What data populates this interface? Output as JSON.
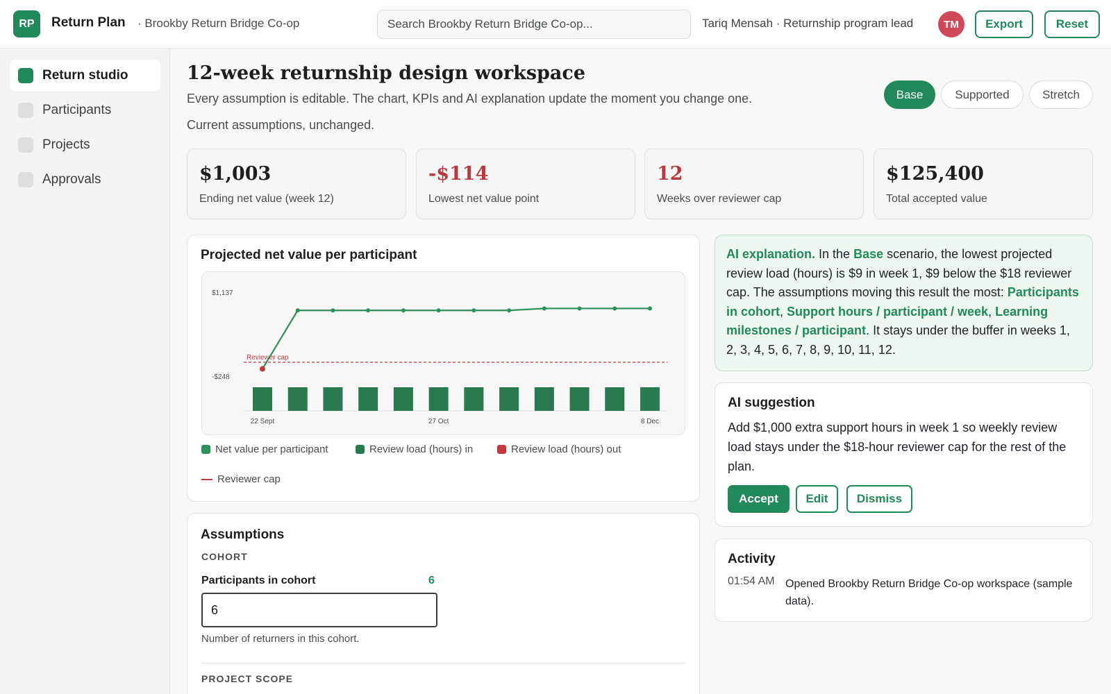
{
  "header": {
    "logo_initials": "RP",
    "app_title": "Return Plan",
    "org_name": "· Brookby Return Bridge Co-op",
    "search_placeholder": "Search Brookby Return Bridge Co-op...",
    "user_info": "Tariq Mensah · Returnship program lead",
    "avatar_initials": "TM",
    "export_label": "Export",
    "reset_label": "Reset"
  },
  "sidebar": {
    "items": [
      {
        "label": "Return studio",
        "active": true
      },
      {
        "label": "Participants",
        "active": false
      },
      {
        "label": "Projects",
        "active": false
      },
      {
        "label": "Approvals",
        "active": false
      }
    ]
  },
  "main": {
    "title": "12-week returnship design workspace",
    "subtitle": "Every assumption is editable. The chart, KPIs and AI explanation update the moment you change one.",
    "status": "Current assumptions, unchanged.",
    "scenarios": [
      {
        "label": "Base",
        "active": true
      },
      {
        "label": "Supported",
        "active": false
      },
      {
        "label": "Stretch",
        "active": false
      }
    ]
  },
  "kpis": [
    {
      "value": "$1,003",
      "label": "Ending net value (week 12)",
      "negative": false
    },
    {
      "value": "-$114",
      "label": "Lowest net value point",
      "negative": true
    },
    {
      "value": "12",
      "label": "Weeks over reviewer cap",
      "negative": true
    },
    {
      "value": "$125,400",
      "label": "Total accepted value",
      "negative": false
    }
  ],
  "chart_card": {
    "title": "Projected net value per participant",
    "legend": {
      "net_value": "Net value per participant",
      "load_in": "Review load (hours) in",
      "load_out": "Review load (hours) out",
      "cap": "Reviewer cap"
    }
  },
  "chart_data": {
    "type": "line",
    "x_tick_labels": [
      "22 Sept",
      "27 Oct",
      "8 Dec"
    ],
    "y_tick_labels": [
      "$1,137",
      "-$248"
    ],
    "ylim": [
      -248,
      1137
    ],
    "series": [
      {
        "name": "Net value per participant",
        "type": "line",
        "values": [
          -114,
          967,
          967,
          967,
          967,
          967,
          967,
          967,
          1003,
          1003,
          1003,
          1003
        ]
      },
      {
        "name": "Review load (hours) in",
        "type": "bar",
        "values": [
          9,
          9,
          9,
          9,
          9,
          9,
          9,
          9,
          9,
          9,
          9,
          9
        ]
      }
    ],
    "reference_line": {
      "label": "Reviewer cap",
      "value": 0
    },
    "colors": {
      "line": "#2f8f5b",
      "bar": "#2a7a4f",
      "low_point": "#c0393e",
      "cap": "#c0393e"
    },
    "grid": false
  },
  "ai_explanation": {
    "label": "AI explanation.",
    "t1": " In the ",
    "scenario": "Base",
    "t2": " scenario, the lowest projected review load (hours) is $9 in week 1, $9 below the $18 reviewer cap. The assumptions moving this result the most: ",
    "driver1": "Participants in cohort",
    "sep1": ", ",
    "driver2": "Support hours / participant / week",
    "sep2": ", ",
    "driver3": "Learning milestones / participant",
    "t3": ". It stays under the buffer in weeks 1, 2, 3, 4, 5, 6, 7, 8, 9, 10, 11, 12."
  },
  "ai_suggestion": {
    "title": "AI suggestion",
    "text": "Add $1,000 extra support hours in week 1 so weekly review load stays under the $18-hour reviewer cap for the rest of the plan.",
    "accept_label": "Accept",
    "edit_label": "Edit",
    "dismiss_label": "Dismiss"
  },
  "activity": {
    "title": "Activity",
    "entries": [
      {
        "time": "01:54 AM",
        "text": "Opened Brookby Return Bridge Co-op workspace (sample data)."
      }
    ]
  },
  "assumptions": {
    "title": "Assumptions",
    "section_cohort": "COHORT",
    "participants_label": "Participants in cohort",
    "participants_value": "6",
    "participants_input": "6",
    "participants_help": "Number of returners in this cohort.",
    "section_scope": "PROJECT SCOPE"
  },
  "colors": {
    "accent": "#22895a",
    "negative": "#b83a3f",
    "avatar": "#d0495a"
  }
}
